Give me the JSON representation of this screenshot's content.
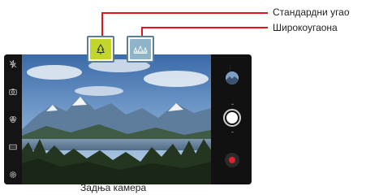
{
  "callouts": {
    "standard_label": "Стандардни угао",
    "wide_label": "Широкоугаона"
  },
  "caption": "Задња камера",
  "lens_buttons": [
    {
      "name": "standard",
      "icon": "tree-icon",
      "active": true
    },
    {
      "name": "wide",
      "icon": "wide-angle-trees-icon",
      "active": false
    }
  ],
  "colors": {
    "callout_line": "#e4141c",
    "lens_border": "#5a7f96",
    "active_lens_fill": "#c2d52b",
    "wide_lens_fill": "#8fb3c7",
    "record_button": "#e0202a"
  },
  "left_bar_icons": [
    "flash-off-icon",
    "camera-switch-icon",
    "filter-icon",
    "aspect-ratio-icon",
    "settings-icon"
  ],
  "right_bar_icons": [
    "gallery-thumbnail-icon",
    "shutter-button-icon",
    "record-button-icon"
  ]
}
